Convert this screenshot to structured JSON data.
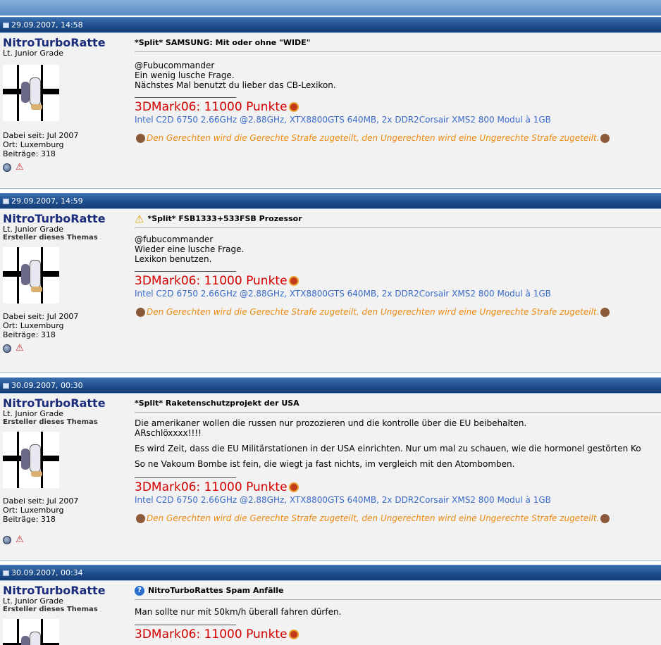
{
  "posts": [
    {
      "date": "29.09.2007, 14:58",
      "username": "NitroTurboRatte",
      "rank": "Lt. Junior Grade",
      "creator": "",
      "joined": "Dabei seit: Jul 2007",
      "location": "Ort: Luxemburg",
      "posts_count": "Beiträge: 318",
      "title_icon": "none",
      "title": "*Split* SAMSUNG: Mit oder ohne \"WIDE\"",
      "lines": [
        "@Fubucommander",
        "Ein wenig lusche Frage.",
        "Nächstes Mal benutzt du lieber das CB-Lexikon."
      ]
    },
    {
      "date": "29.09.2007, 14:59",
      "username": "NitroTurboRatte",
      "rank": "Lt. Junior Grade",
      "creator": "Ersteller dieses Themas",
      "joined": "Dabei seit: Jul 2007",
      "location": "Ort: Luxemburg",
      "posts_count": "Beiträge: 318",
      "title_icon": "warning-icon",
      "title": "*Split* FSB1333+533FSB Prozessor",
      "lines": [
        "@fubucommander",
        "Wieder eine lusche Frage.",
        "Lexikon benutzen."
      ]
    },
    {
      "date": "30.09.2007, 00:30",
      "username": "NitroTurboRatte",
      "rank": "Lt. Junior Grade",
      "creator": "Ersteller dieses Themas",
      "joined": "Dabei seit: Jul 2007",
      "location": "Ort: Luxemburg",
      "posts_count": "Beiträge: 318",
      "title_icon": "none",
      "title": "*Split* Raketenschutzprojekt der USA",
      "paragraphs": [
        "Die amerikaner wollen die russen nur prozozieren und die kontrolle über die EU beibehalten.",
        "ARschlöxxxx!!!!",
        "Es wird Zeit, dass die EU Militärstationen in der USA einrichten. Nur um mal zu schauen, wie die hormonel gestörten Ko",
        "So ne Vakoum Bombe ist fein, die wiegt ja fast nichts, im vergleich mit den Atombomben."
      ]
    },
    {
      "date": "30.09.2007, 00:34",
      "username": "NitroTurboRatte",
      "rank": "Lt. Junior Grade",
      "creator": "Ersteller dieses Themas",
      "title_icon": "question-icon",
      "title": "NitroTurboRattes Spam Anfälle",
      "lines": [
        "Man sollte nur mit 50km/h überall fahren dürfen."
      ]
    }
  ],
  "signature": {
    "benchmark": "3DMark06: 11000 Punkte",
    "specs": "Intel C2D 6750 2.66GHz @2.88GHz, XTX8800GTS 640MB, 2x DDR2Corsair XMS2 800 Modul à 1GB",
    "quote": "Den Gerechten wird die Gerechte Strafe zugeteilt, den Ungerechten wird eine Ungerechte Strafe zugeteilt."
  },
  "colors": {
    "header": "#1e4d8c",
    "username": "#1a2c7a",
    "benchmark": "#d40000",
    "specs": "#3a6ac8",
    "quote": "#ee8a10"
  }
}
